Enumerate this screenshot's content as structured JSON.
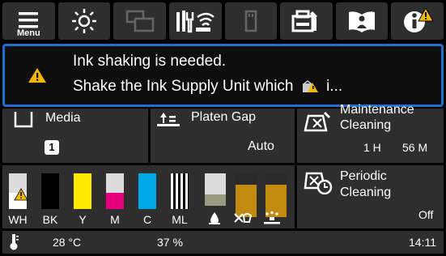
{
  "toolbar": {
    "menu_label": "Menu",
    "icons": [
      "menu-icon",
      "brightness-icon",
      "copy-icon",
      "network-wifi-icon",
      "usb-icon",
      "maintenance-icon",
      "manual-icon",
      "info-icon"
    ]
  },
  "alert": {
    "line1": "Ink shaking is needed.",
    "line2_before": "Shake the Ink Supply Unit which",
    "line2_after": "i..."
  },
  "media": {
    "label": "Media",
    "badge": "1"
  },
  "platen_gap": {
    "label": "Platen Gap",
    "value": "Auto"
  },
  "maintenance": {
    "line1": "Maintenance",
    "line2": "Cleaning",
    "value_h": "1 H",
    "value_m": "56 M"
  },
  "inks": [
    {
      "label": "WH",
      "color": "#ffffff",
      "level": 0.45,
      "warning": true
    },
    {
      "label": "BK",
      "color": "#000000",
      "level": 1.0
    },
    {
      "label": "Y",
      "color": "#ffe800",
      "level": 1.0
    },
    {
      "label": "M",
      "color": "#e6007e",
      "level": 0.45
    },
    {
      "label": "C",
      "color": "#00a8e8",
      "level": 1.0
    },
    {
      "label": "ML",
      "color": "#ffffff",
      "level": 1.0
    }
  ],
  "tanks": [
    {
      "name": "waste-ink",
      "color": "#9a9a80",
      "level": 0.35
    },
    {
      "name": "cleaning-liquid",
      "color": "#c38a10",
      "level": 0.65
    },
    {
      "name": "pretreatment",
      "color": "#c38a10",
      "level": 0.65
    }
  ],
  "periodic": {
    "line1": "Periodic",
    "line2": "Cleaning",
    "value": "Off"
  },
  "status_bar": {
    "temperature": "28 °C",
    "humidity": "37 %",
    "time": "14:11"
  },
  "colors": {
    "alert_border": "#1e6fd0",
    "warning": "#f5b800",
    "panel": "#2e2e2e"
  }
}
